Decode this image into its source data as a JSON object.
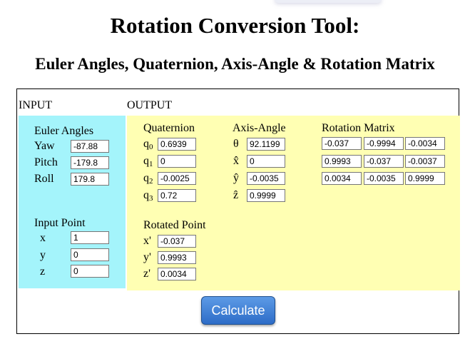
{
  "title": "Rotation Conversion Tool:",
  "subtitle": "Euler Angles, Quaternion, Axis-Angle & Rotation Matrix",
  "input": {
    "section_label": "INPUT",
    "euler": {
      "heading": "Euler Angles",
      "yaw_label": "Yaw",
      "yaw": "-87.88",
      "pitch_label": "Pitch",
      "pitch": "-179.8",
      "roll_label": "Roll",
      "roll": "179.8"
    },
    "point": {
      "heading": "Input Point",
      "x_label": "x",
      "x": "1",
      "y_label": "y",
      "y": "0",
      "z_label": "z",
      "z": "0"
    }
  },
  "output": {
    "section_label": "OUTPUT",
    "quaternion": {
      "heading": "Quaternion",
      "q_symbol": "q",
      "sub0": "0",
      "q0": "0.6939",
      "sub1": "1",
      "q1": "0",
      "sub2": "2",
      "q2": "-0.0025",
      "sub3": "3",
      "q3": "0.72"
    },
    "axis_angle": {
      "heading": "Axis-Angle",
      "theta_label": "θ",
      "theta": "92.1199",
      "x_label": "x̂",
      "x": "0",
      "y_label": "ŷ",
      "y": "-0.0035",
      "z_label": "ẑ",
      "z": "0.9999"
    },
    "matrix": {
      "heading": "Rotation Matrix",
      "rows": [
        [
          "-0.037",
          "-0.9994",
          "-0.0034"
        ],
        [
          "0.9993",
          "-0.037",
          "-0.0037"
        ],
        [
          "0.0034",
          "-0.0035",
          "0.9999"
        ]
      ]
    },
    "rotated_point": {
      "heading": "Rotated Point",
      "x_label": "x'",
      "x": "-0.037",
      "y_label": "y'",
      "y": "0.9993",
      "z_label": "z'",
      "z": "0.0034"
    }
  },
  "calculate_label": "Calculate",
  "colors": {
    "input_bg": "#a4f4fb",
    "output_bg": "#ffffb3",
    "button": "#3d7ed6"
  }
}
